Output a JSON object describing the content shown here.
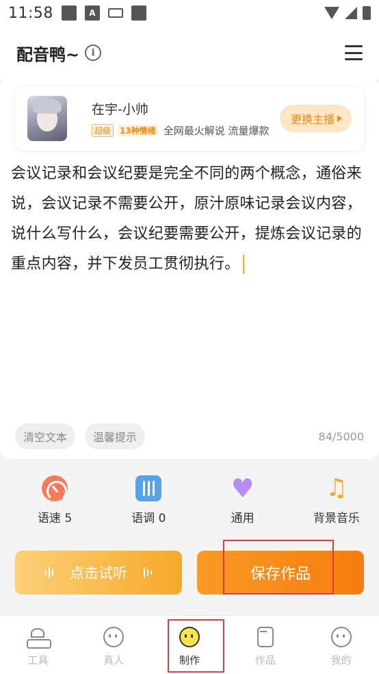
{
  "status_bar": {
    "time": "11:58",
    "icons": [
      "notification-icon",
      "a-icon",
      "keyboard-icon",
      "square-icon",
      "wifi-icon",
      "signal-icon",
      "battery-icon"
    ]
  },
  "header": {
    "title": "配音鸭~",
    "info_icon": "info-icon",
    "menu_icon": "menu-icon"
  },
  "voice": {
    "name": "在宇-小帅",
    "tag_level": "超级",
    "tag_emotions": "13种情绪",
    "description": "全网最火解说 流量爆款",
    "switch_label": "更换主播"
  },
  "editor": {
    "text": "会议记录和会议纪要是完全不同的两个概念，通俗来说，会议记录不需要公开，原汁原味记录会议内容，说什么写什么，会议纪要需要公开，提炼会议记录的重点内容，并下发员工贯彻执行。",
    "clear_label": "清空文本",
    "tips_label": "温馨提示",
    "counter": "84/5000"
  },
  "settings": {
    "speed_label": "语速 5",
    "tone_label": "语调 0",
    "emotion_label": "通用",
    "music_label": "背景音乐"
  },
  "actions": {
    "listen_label": "点击试听",
    "save_label": "保存作品"
  },
  "tabbar": {
    "tools": "工具",
    "human": "真人",
    "make": "制作",
    "works": "作品",
    "mine": "我的"
  },
  "colors": {
    "accent": "#f67d0e",
    "accent_light": "#fcd07a",
    "highlight": "#e0393e"
  }
}
